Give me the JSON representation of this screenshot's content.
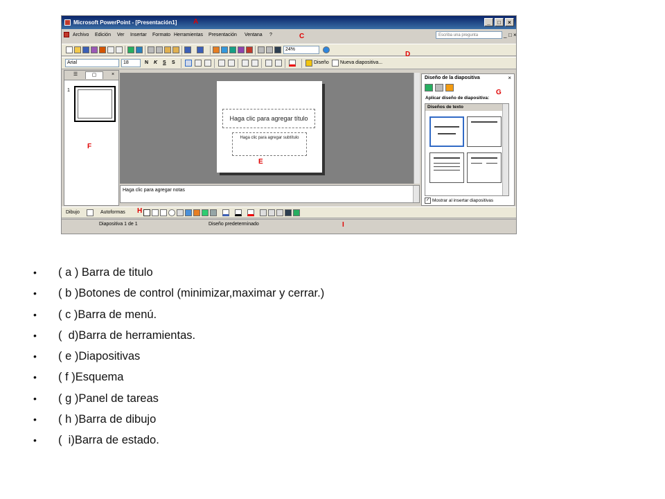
{
  "window": {
    "title": "Microsoft PowerPoint - [Presentación1]",
    "controls": [
      "_",
      "□",
      "×"
    ],
    "mdi_controls": [
      "_",
      "□",
      "×"
    ]
  },
  "menu": {
    "items": [
      "Archivo",
      "Edición",
      "Ver",
      "Insertar",
      "Formato",
      "Herramientas",
      "Presentación",
      "Ventana",
      "?"
    ],
    "help_placeholder": "Escriba una pregunta"
  },
  "toolbar_standard": {
    "zoom": "24%"
  },
  "toolbar_format": {
    "font": "Arial",
    "size": "18",
    "bold": "N",
    "italic": "K",
    "underline": "S",
    "shadow": "S",
    "design_label": "Diseño",
    "new_slide_label": "Nueva diapositiva..."
  },
  "thumbnails": {
    "number": "1"
  },
  "slide": {
    "title_placeholder": "Haga clic para agregar título",
    "subtitle_placeholder": "Haga clic para agregar subtítulo"
  },
  "notes_placeholder": "Haga clic para agregar notas",
  "taskpane": {
    "title": "Diseño de la diapositiva",
    "subtitle": "Aplicar diseño de diapositiva:",
    "section": "Diseños de texto",
    "checkbox_label": "Mostrar al insertar diapositivas"
  },
  "drawing": {
    "draw_label": "Dibujo",
    "autoshapes_label": "Autoformas"
  },
  "status": {
    "slide": "Diapositiva 1 de 1",
    "design": "Diseño predeterminado"
  },
  "callouts": {
    "a": "A",
    "c": "C",
    "d": "D",
    "e": "E",
    "f": "F",
    "g": "G",
    "h": "H",
    "i": "I"
  },
  "legend": [
    "( a ) Barra de titulo",
    "( b )Botones de control (minimizar,maximar y cerrar.)",
    "( c )Barra de menú.",
    "(  d)Barra de herramientas.",
    "( e )Diapositivas",
    "( f )Esquema",
    "( g )Panel de tareas",
    "( h )Barra de dibujo",
    "(  i)Barra de estado."
  ]
}
